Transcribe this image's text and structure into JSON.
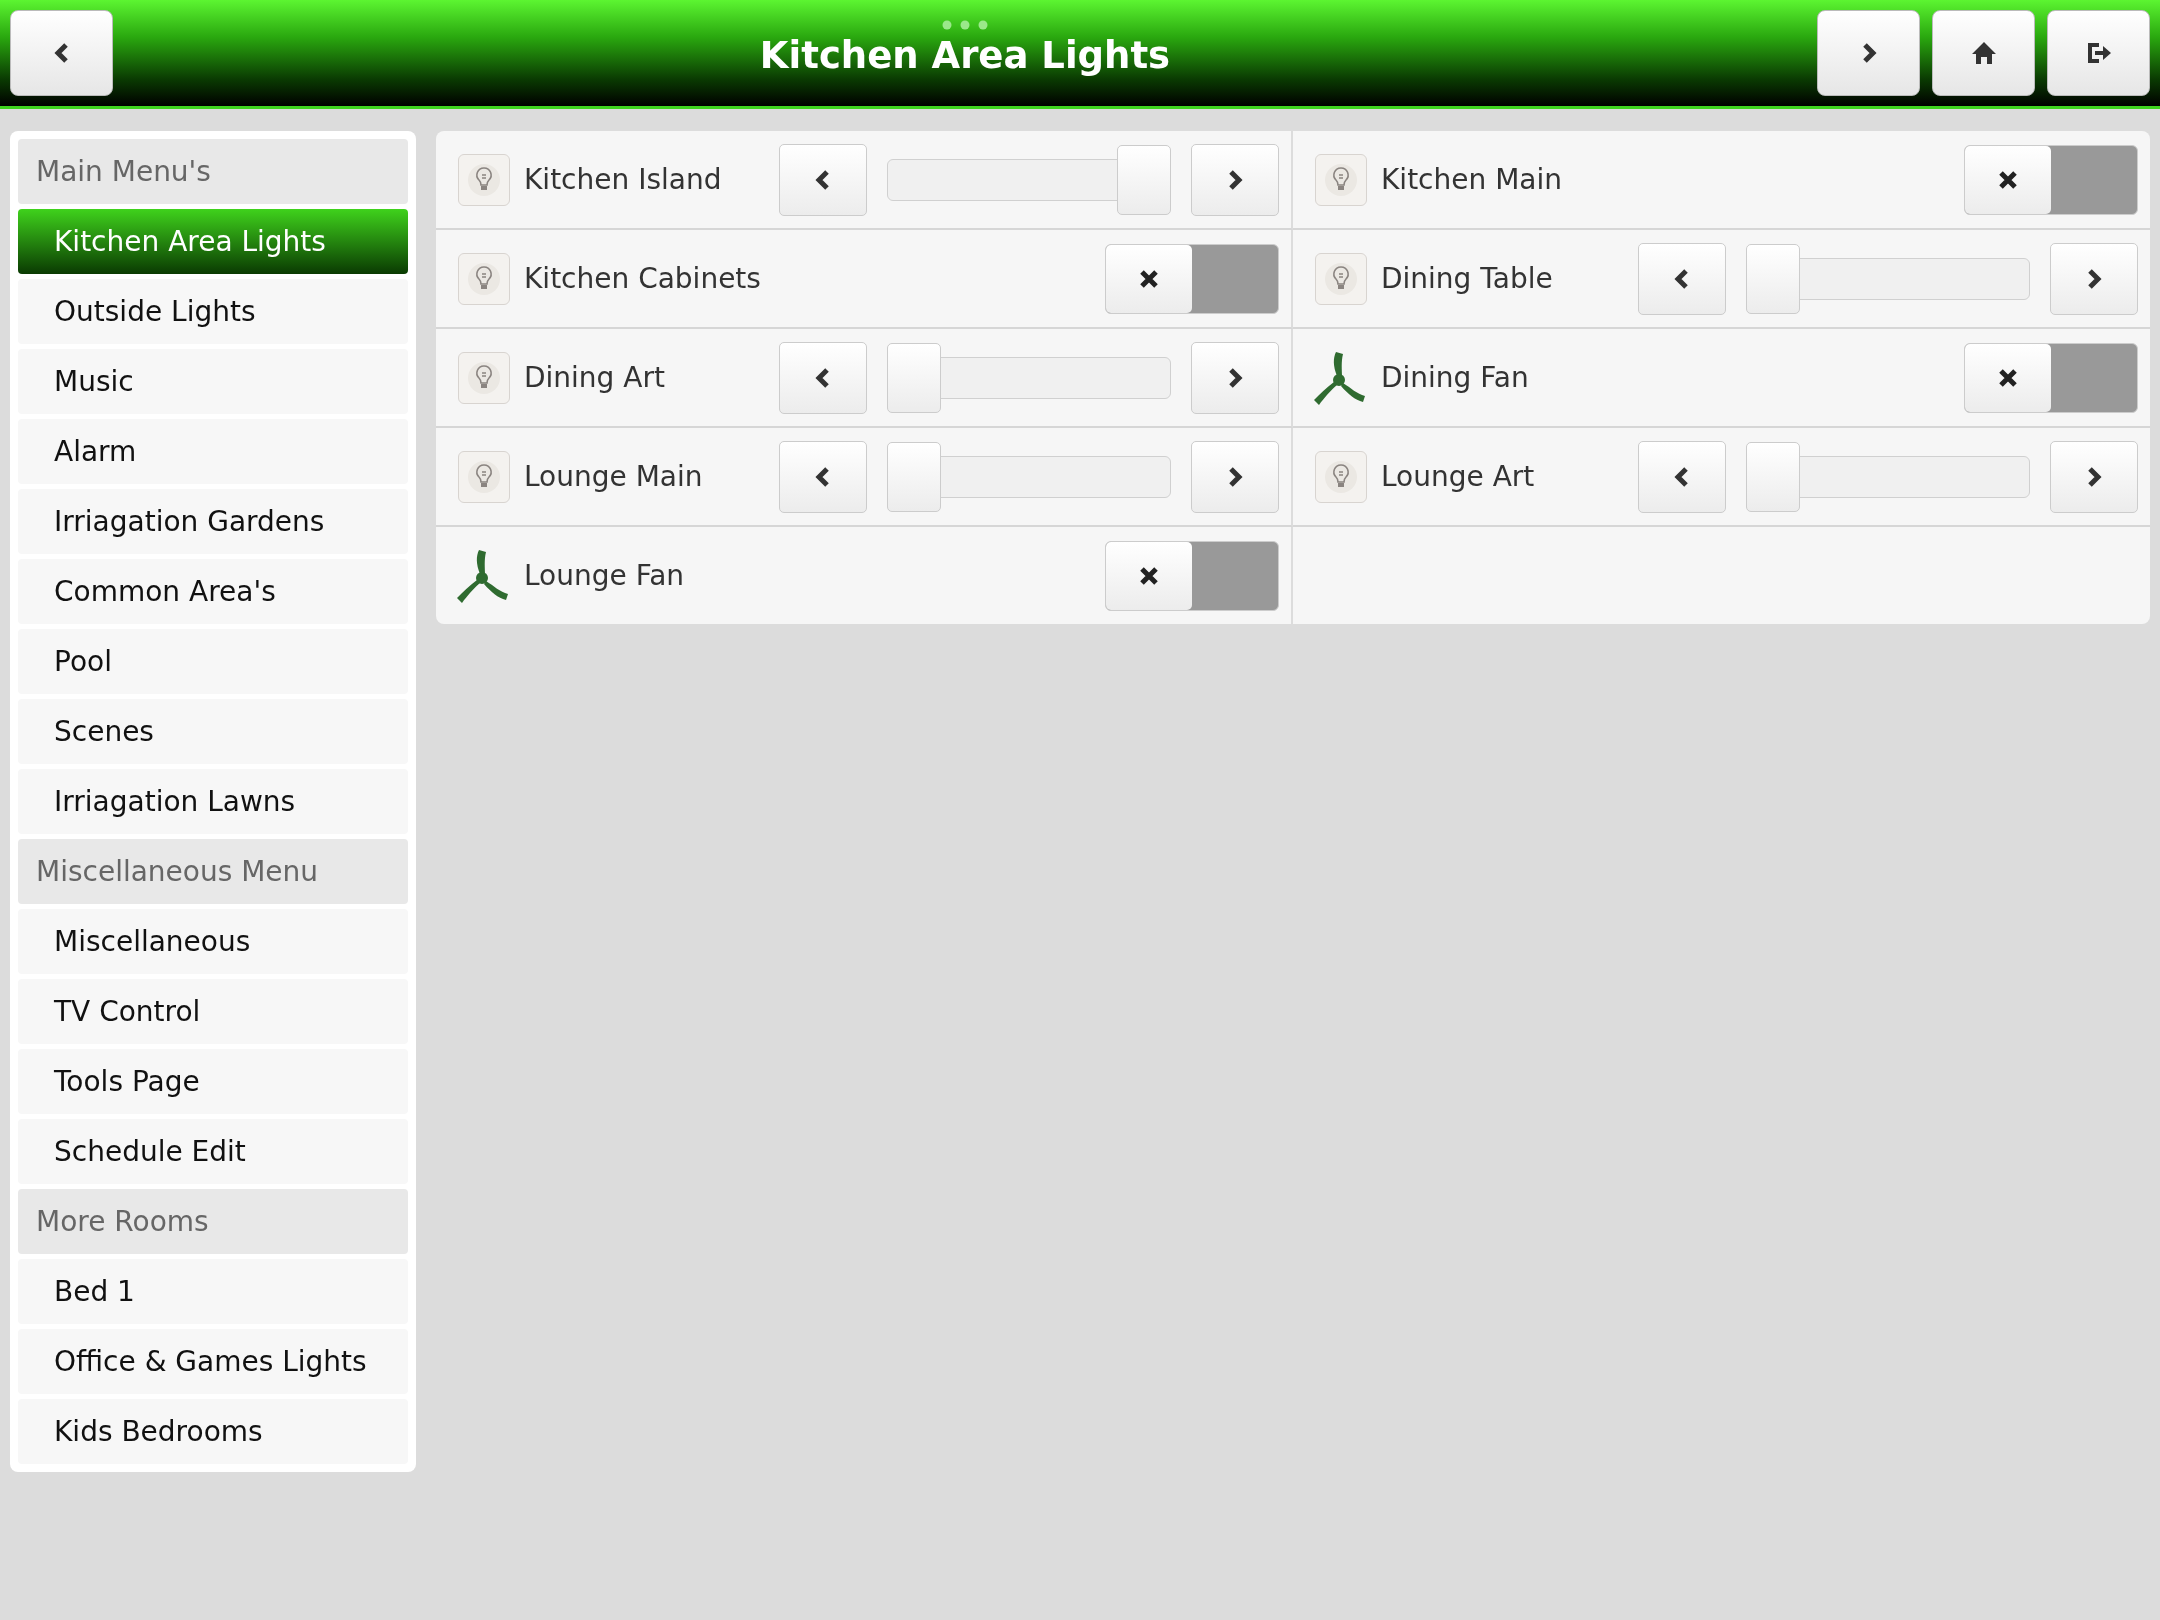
{
  "header": {
    "title": "Kitchen Area Lights"
  },
  "sidebar": {
    "items": [
      {
        "kind": "header",
        "label": "Main Menu's",
        "selected": false
      },
      {
        "kind": "item",
        "label": "Kitchen Area Lights",
        "selected": true
      },
      {
        "kind": "item",
        "label": "Outside Lights",
        "selected": false
      },
      {
        "kind": "item",
        "label": "Music",
        "selected": false
      },
      {
        "kind": "item",
        "label": "Alarm",
        "selected": false
      },
      {
        "kind": "item",
        "label": "Irriagation Gardens",
        "selected": false
      },
      {
        "kind": "item",
        "label": "Common Area's",
        "selected": false
      },
      {
        "kind": "item",
        "label": "Pool",
        "selected": false
      },
      {
        "kind": "item",
        "label": "Scenes",
        "selected": false
      },
      {
        "kind": "item",
        "label": "Irriagation Lawns",
        "selected": false
      },
      {
        "kind": "header",
        "label": "Miscellaneous Menu",
        "selected": false
      },
      {
        "kind": "item",
        "label": "Miscellaneous",
        "selected": false
      },
      {
        "kind": "item",
        "label": "TV Control",
        "selected": false
      },
      {
        "kind": "item",
        "label": "Tools Page",
        "selected": false
      },
      {
        "kind": "item",
        "label": "Schedule Edit",
        "selected": false
      },
      {
        "kind": "header",
        "label": "More Rooms",
        "selected": false
      },
      {
        "kind": "item",
        "label": "Bed 1",
        "selected": false
      },
      {
        "kind": "item",
        "label": "Office & Games Lights",
        "selected": false
      },
      {
        "kind": "item",
        "label": "Kids Bedrooms",
        "selected": false
      }
    ]
  },
  "devices": [
    {
      "name": "Kitchen Island",
      "kind": "dimmer",
      "level": 1
    },
    {
      "name": "Kitchen Main",
      "kind": "switch",
      "on": false
    },
    {
      "name": "Kitchen Cabinets",
      "kind": "switch",
      "on": false
    },
    {
      "name": "Dining Table",
      "kind": "dimmer",
      "level": 0
    },
    {
      "name": "Dining Art",
      "kind": "dimmer",
      "level": 0
    },
    {
      "name": "Dining Fan",
      "kind": "fan",
      "on": false
    },
    {
      "name": "Lounge Main",
      "kind": "dimmer",
      "level": 0
    },
    {
      "name": "Lounge Art",
      "kind": "dimmer",
      "level": 0
    },
    {
      "name": "Lounge Fan",
      "kind": "fan",
      "on": false
    }
  ]
}
